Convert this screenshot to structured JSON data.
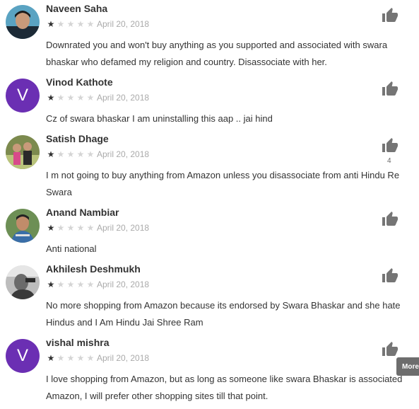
{
  "reviews": [
    {
      "name": "Naveen Saha",
      "rating": 1,
      "date": "April 20, 2018",
      "avatar": "photo",
      "helpful_count": "",
      "lines": [
        "Downrated you and won't buy anything as you supported and associated with swara",
        "bhaskar who defamed my religion and country. Disassociate with her."
      ]
    },
    {
      "name": "Vinod Kathote",
      "rating": 1,
      "date": "April 20, 2018",
      "avatar_letter": "V",
      "helpful_count": "",
      "lines": [
        "Cz of swara bhaskar I am uninstalling this aap .. jai hind"
      ]
    },
    {
      "name": "Satish Dhage",
      "rating": 1,
      "date": "April 20, 2018",
      "avatar": "photo",
      "helpful_count": "4",
      "lines": [
        "I m not going to buy anything from Amazon unless you disassociate from anti Hindu Re",
        "Swara"
      ]
    },
    {
      "name": "Anand Nambiar",
      "rating": 1,
      "date": "April 20, 2018",
      "avatar": "photo",
      "helpful_count": "",
      "lines": [
        "Anti national"
      ]
    },
    {
      "name": "Akhilesh Deshmukh",
      "rating": 1,
      "date": "April 20, 2018",
      "avatar": "photo",
      "helpful_count": "",
      "lines": [
        "No more shopping from Amazon because its endorsed by Swara Bhaskar and she hate",
        "Hindus and I Am Hindu Jai Shree Ram"
      ]
    },
    {
      "name": "vishal mishra",
      "rating": 1,
      "date": "April 20, 2018",
      "avatar_letter": "V",
      "helpful_count": "",
      "lines": [
        "I love shopping from Amazon, but as long as someone like swara Bhaskar is associated",
        "Amazon, I will prefer other shopping sites till that point."
      ]
    }
  ],
  "more_button_label": "More",
  "colors": {
    "letter_avatar": "#6b2fb3",
    "star_filled": "#333333",
    "star_empty": "#d5d5d5",
    "date": "#aaaaaa",
    "thumb": "#757575"
  }
}
